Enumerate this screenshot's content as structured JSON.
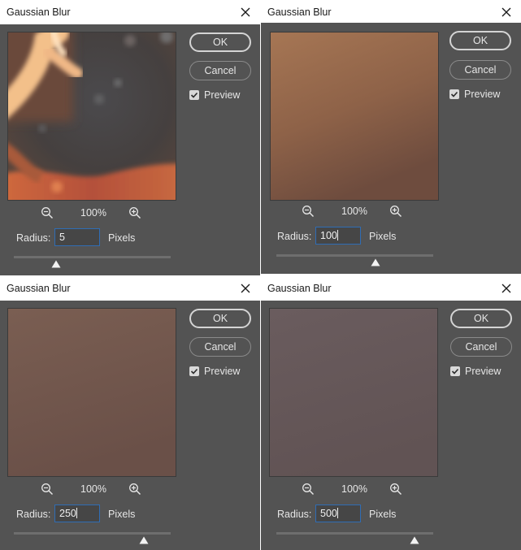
{
  "dialogs": [
    {
      "title": "Gaussian Blur",
      "ok_label": "OK",
      "cancel_label": "Cancel",
      "preview_label": "Preview",
      "preview_checked": true,
      "zoom_label": "100%",
      "radius_label": "Radius:",
      "radius_value": "5",
      "unit_label": "Pixels",
      "slider_level": 0.27
    },
    {
      "title": "Gaussian Blur",
      "ok_label": "OK",
      "cancel_label": "Cancel",
      "preview_label": "Preview",
      "preview_checked": true,
      "zoom_label": "100%",
      "radius_label": "Radius:",
      "radius_value": "100",
      "unit_label": "Pixels",
      "slider_level": 0.63
    },
    {
      "title": "Gaussian Blur",
      "ok_label": "OK",
      "cancel_label": "Cancel",
      "preview_label": "Preview",
      "preview_checked": true,
      "zoom_label": "100%",
      "radius_label": "Radius:",
      "radius_value": "250",
      "unit_label": "Pixels",
      "slider_level": 0.83
    },
    {
      "title": "Gaussian Blur",
      "ok_label": "OK",
      "cancel_label": "Cancel",
      "preview_label": "Preview",
      "preview_checked": true,
      "zoom_label": "100%",
      "radius_label": "Radius:",
      "radius_value": "500",
      "unit_label": "Pixels",
      "slider_level": 0.88
    }
  ],
  "colors": {
    "dialog_bg": "#535353",
    "titlebar_bg": "#ffffff",
    "input_border": "#2f6db5",
    "preview_blur_250": "#72584d",
    "preview_blur_500": "#645658"
  },
  "icons": [
    "close-icon",
    "zoom-out-icon",
    "zoom-in-icon",
    "checkmark-icon",
    "slider-thumb-icon"
  ]
}
